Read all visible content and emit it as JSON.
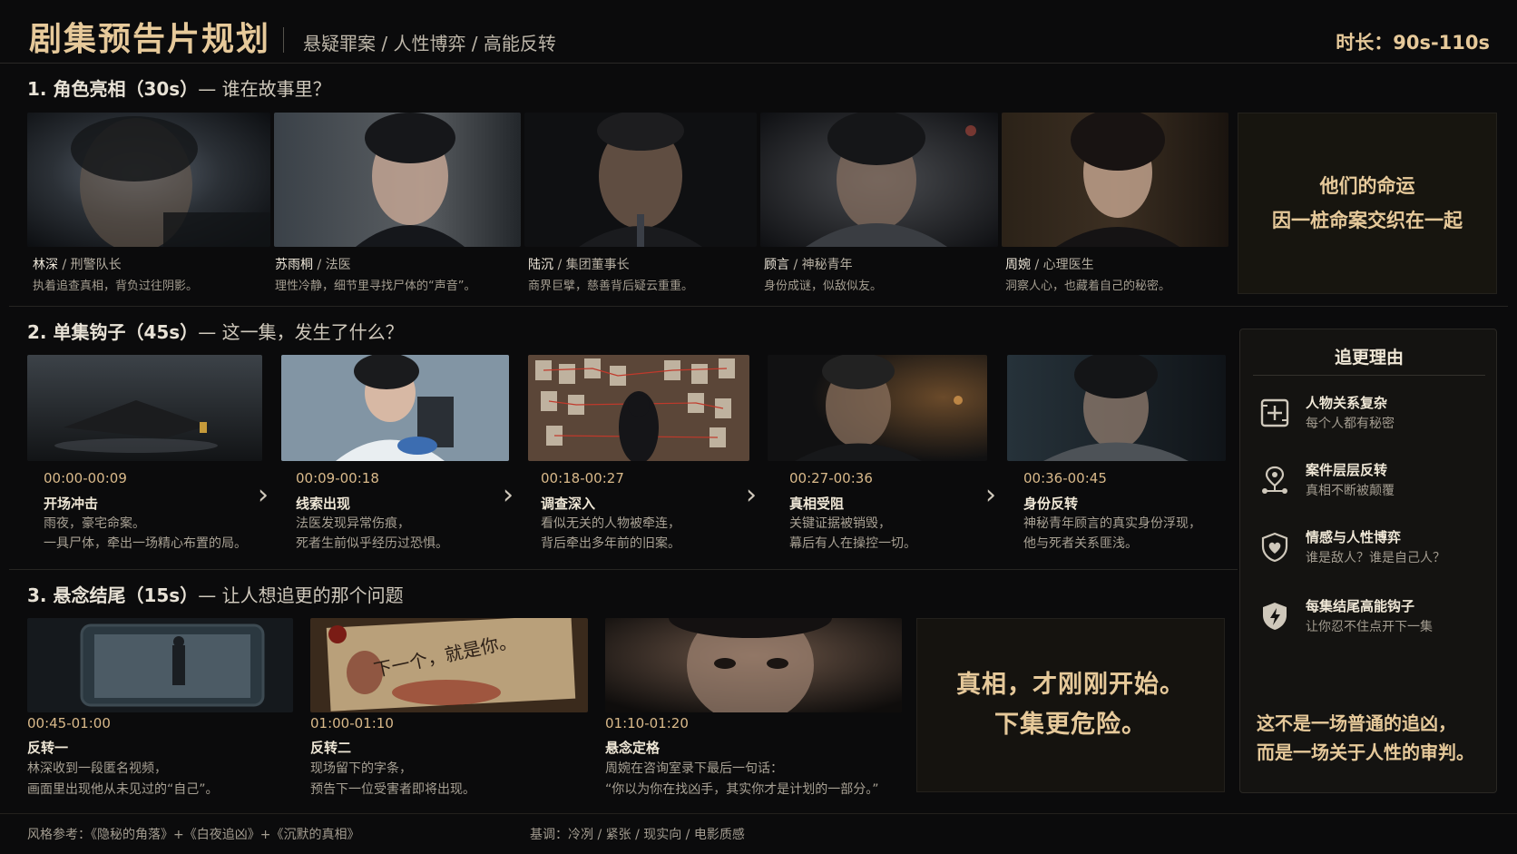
{
  "header": {
    "title": "剧集预告片规划",
    "subtitle": "悬疑罪案 / 人性博弈 / 高能反转",
    "duration": "时长：90s-110s"
  },
  "section1": {
    "number": "1. 角色亮相（30s）",
    "question": "— 谁在故事里？",
    "characters": [
      {
        "name": "林深",
        "role": " / 刑警队长",
        "desc": "执着追查真相，背负过往阴影。"
      },
      {
        "name": "苏雨桐",
        "role": " / 法医",
        "desc": "理性冷静，细节里寻找尸体的“声音”。"
      },
      {
        "name": "陆沉",
        "role": " / 集团董事长",
        "desc": "商界巨擘，慈善背后疑云重重。"
      },
      {
        "name": "顾言",
        "role": " / 神秘青年",
        "desc": "身份成谜，似敌似友。"
      },
      {
        "name": "周婉",
        "role": " / 心理医生",
        "desc": "洞察人心，也藏着自己的秘密。"
      }
    ],
    "fate_lines": [
      "他们的命运",
      "因一桩命案交织在一起"
    ]
  },
  "section2": {
    "number": "2. 单集钩子（45s）",
    "question": "— 这一集，发生了什么？",
    "beats": [
      {
        "time": "00:00-00:09",
        "title": "开场冲击",
        "desc1": "雨夜，豪宅命案。",
        "desc2": "一具尸体，牵出一场精心布置的局。"
      },
      {
        "time": "00:09-00:18",
        "title": "线索出现",
        "desc1": "法医发现异常伤痕，",
        "desc2": "死者生前似乎经历过恐惧。"
      },
      {
        "time": "00:18-00:27",
        "title": "调查深入",
        "desc1": "看似无关的人物被牵连，",
        "desc2": "背后牵出多年前的旧案。"
      },
      {
        "time": "00:27-00:36",
        "title": "真相受阻",
        "desc1": "关键证据被销毁，",
        "desc2": "幕后有人在操控一切。"
      },
      {
        "time": "00:36-00:45",
        "title": "身份反转",
        "desc1": "神秘青年顾言的真实身份浮现，",
        "desc2": "他与死者关系匪浅。"
      }
    ],
    "arrow_icon": "chevron-right-icon"
  },
  "section3": {
    "number": "3. 悬念结尾（15s）",
    "question": "— 让人想追更的那个问题",
    "beats": [
      {
        "time": "00:45-01:00",
        "title": "反转一",
        "desc1": "林深收到一段匿名视频，",
        "desc2": "画面里出现他从未见过的“自己”。"
      },
      {
        "time": "01:00-01:10",
        "title": "反转二",
        "desc1": "现场留下的字条，",
        "desc2": "预告下一位受害者即将出现。"
      },
      {
        "time": "01:10-01:20",
        "title": "悬念定格",
        "desc1": "周婉在咨询室录下最后一句话：",
        "desc2": "“你以为你在找凶手，其实你才是计划的一部分。”"
      }
    ],
    "note_text": "下一个，就是你。",
    "truth_lines": [
      "真相，才刚刚开始。",
      "下集更危险。"
    ]
  },
  "reasons": {
    "title": "追更理由",
    "items": [
      {
        "icon": "network-plus-icon",
        "title": "人物关系复杂",
        "sub": "每个人都有秘密"
      },
      {
        "icon": "location-network-icon",
        "title": "案件层层反转",
        "sub": "真相不断被颠覆"
      },
      {
        "icon": "heart-shield-icon",
        "title": "情感与人性博弈",
        "sub": "谁是敌人？谁是自己人？"
      },
      {
        "icon": "lightning-shield-icon",
        "title": "每集结尾高能钩子",
        "sub": "让你忍不住点开下一集"
      }
    ],
    "verdict1": "这不是一场普通的追凶，",
    "verdict2": "而是一场关于人性的审判。"
  },
  "footer": {
    "style_ref": "风格参考：《隐秘的角落》+《白夜追凶》+《沉默的真相》",
    "tone": "基调：冷冽 / 紧张 / 现实向 / 电影质感"
  },
  "colors": {
    "accent_gold": "#e6c99a",
    "background": "#0b0b0c",
    "panel": "#141311"
  }
}
